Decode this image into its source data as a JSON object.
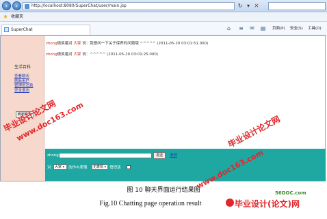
{
  "browser": {
    "url": "http://localhost:8080/SuperChat/user/main.jsp",
    "favorites_label": "收藏夹",
    "tab_title": "SuperChat",
    "tools": {
      "page": "页面(P)",
      "safety": "安全(S)",
      "tools": "工具(O)"
    }
  },
  "sidebar": {
    "title": "生活百科",
    "links": [
      "查看聊天",
      "刷新用户",
      "管理员消息",
      "安全退出"
    ],
    "button_label": "刷新聊天"
  },
  "chat": {
    "messages": [
      {
        "sender": "zhong",
        "verb": "微笑着对",
        "target": "大家",
        "text": "说：我想问一下关于保养的问题哦 ^^^^^",
        "time": "(2011-05-20 03:01:51.000)"
      },
      {
        "sender": "zhong",
        "verb": "微笑着对",
        "target": "大家",
        "text": "说：^^^^^",
        "time": "(2011-05-20 03:01:25.000)"
      }
    ]
  },
  "input_bar": {
    "user_label": "zhong:",
    "send_label": "发送",
    "clear_label": "清屏",
    "to_label": "对",
    "to_value": "大家",
    "action_label": "动作与表情",
    "action_value": "无表情",
    "whisper_label": "悄悄话"
  },
  "captions": {
    "cn": "图 10  聊天界面运行结果图",
    "en": "Fig.10 Chatting page operation result"
  },
  "watermarks": {
    "text1": "毕业设计论文网",
    "text2": "www.doc163.com",
    "site": "56DOC.com",
    "brand": "毕业设计(论文)网"
  },
  "colors": {
    "sidebar_bg": "#f6d8cc",
    "input_bar_bg": "#1fa7a1",
    "accent_red": "#c0301e"
  }
}
